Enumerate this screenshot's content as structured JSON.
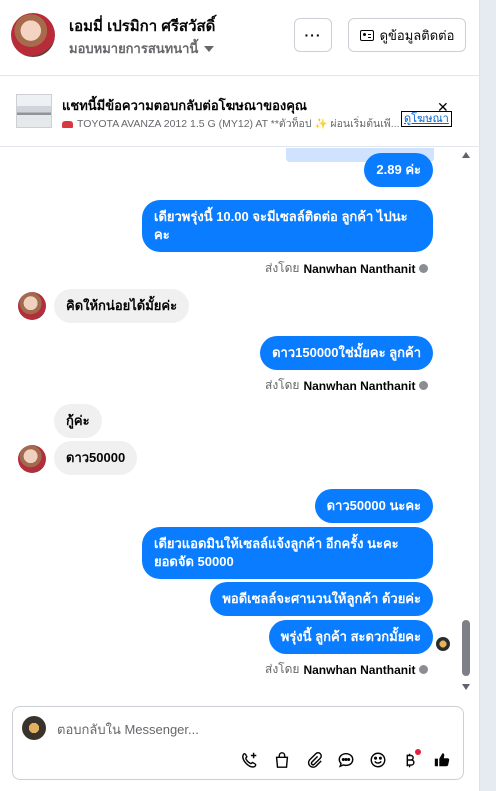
{
  "header": {
    "name": "เอมมี่ เปรมิกา ศรีสวัสดิ์",
    "assign_label": "มอบหมายการสนทนานี้",
    "more_label": "···",
    "contact_info_label": "ดูข้อมูลติดต่อ"
  },
  "ad": {
    "title": "แชทนี้มีข้อความตอบกลับต่อโฆษณาของคุณ",
    "subtitle": "TOYOTA AVANZA 2012 1.5 G (MY12) AT **ตัวท็อป ✨ ผ่อนเริ่มต้นเพี...",
    "link_label": "ดูโฆษณา",
    "close_label": "✕"
  },
  "messages": {
    "m1": "2.89 ค่ะ",
    "m2": "เดียวพรุ่งนี้ 10.00 จะมีเซลล์ติดต่อ ลูกค้า ไปนะคะ",
    "m3": "คิดให้กน่อยได้มั้ยค่ะ",
    "m4": "ดาว150000ใช่มั้ยคะ  ลูกค้า",
    "m5": "กู้ค่ะ",
    "m6": "ดาว50000",
    "m7": "ดาว50000 นะคะ",
    "m8": "เดียวแอดมินให้เซลล์แจ้งลูกค้า อีกครั้ง นะคะ ยอดจัด  50000",
    "m9": "พอดีเซลล์จะศานวนให้ลูกค้า ด้วยค่ะ",
    "m10": "พรุ่งนี้ ลูกค้า สะดวกมั้ยคะ"
  },
  "sent_by": {
    "prefix": "ส่งโดย",
    "sender": "Nanwhan Nanthanit"
  },
  "composer": {
    "placeholder": "ตอบกลับใน Messenger..."
  },
  "icons": [
    "call-add-icon",
    "bag-icon",
    "attach-icon",
    "chat-bubble-icon",
    "emoji-icon",
    "baht-icon",
    "like-icon"
  ],
  "colors": {
    "outgoing_bubble": "#0a7cff",
    "incoming_bubble": "#f0f0f0",
    "link": "#0064d1"
  }
}
